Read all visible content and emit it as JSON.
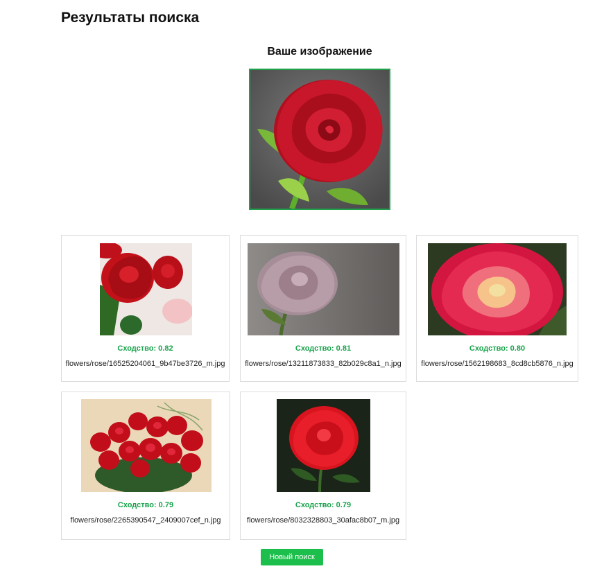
{
  "page": {
    "title": "Результаты поиска"
  },
  "query": {
    "heading": "Ваше изображение",
    "image_icon": "red-rose-photo"
  },
  "results": [
    {
      "similarity": "Сходство: 0.82",
      "filename": "flowers/rose/16525204061_9b47be3726_m.jpg",
      "image_icon": "red-roses-bouquet-photo"
    },
    {
      "similarity": "Сходство: 0.81",
      "filename": "flowers/rose/13211873833_82b029c8a1_n.jpg",
      "image_icon": "lilac-rose-photo"
    },
    {
      "similarity": "Сходство: 0.80",
      "filename": "flowers/rose/1562198683_8cd8cb5876_n.jpg",
      "image_icon": "pink-yellow-rose-photo"
    },
    {
      "similarity": "Сходство: 0.79",
      "filename": "flowers/rose/2265390547_2409007cef_n.jpg",
      "image_icon": "red-rose-bouquet-vase-photo"
    },
    {
      "similarity": "Сходство: 0.79",
      "filename": "flowers/rose/8032328803_30afac8b07_m.jpg",
      "image_icon": "red-rose-dark-background-photo"
    }
  ],
  "actions": {
    "new_search_label": "Новый поиск"
  },
  "colors": {
    "accent": "#1cbf4b",
    "score_text": "#16a34a",
    "query_border": "#1fa04a"
  }
}
